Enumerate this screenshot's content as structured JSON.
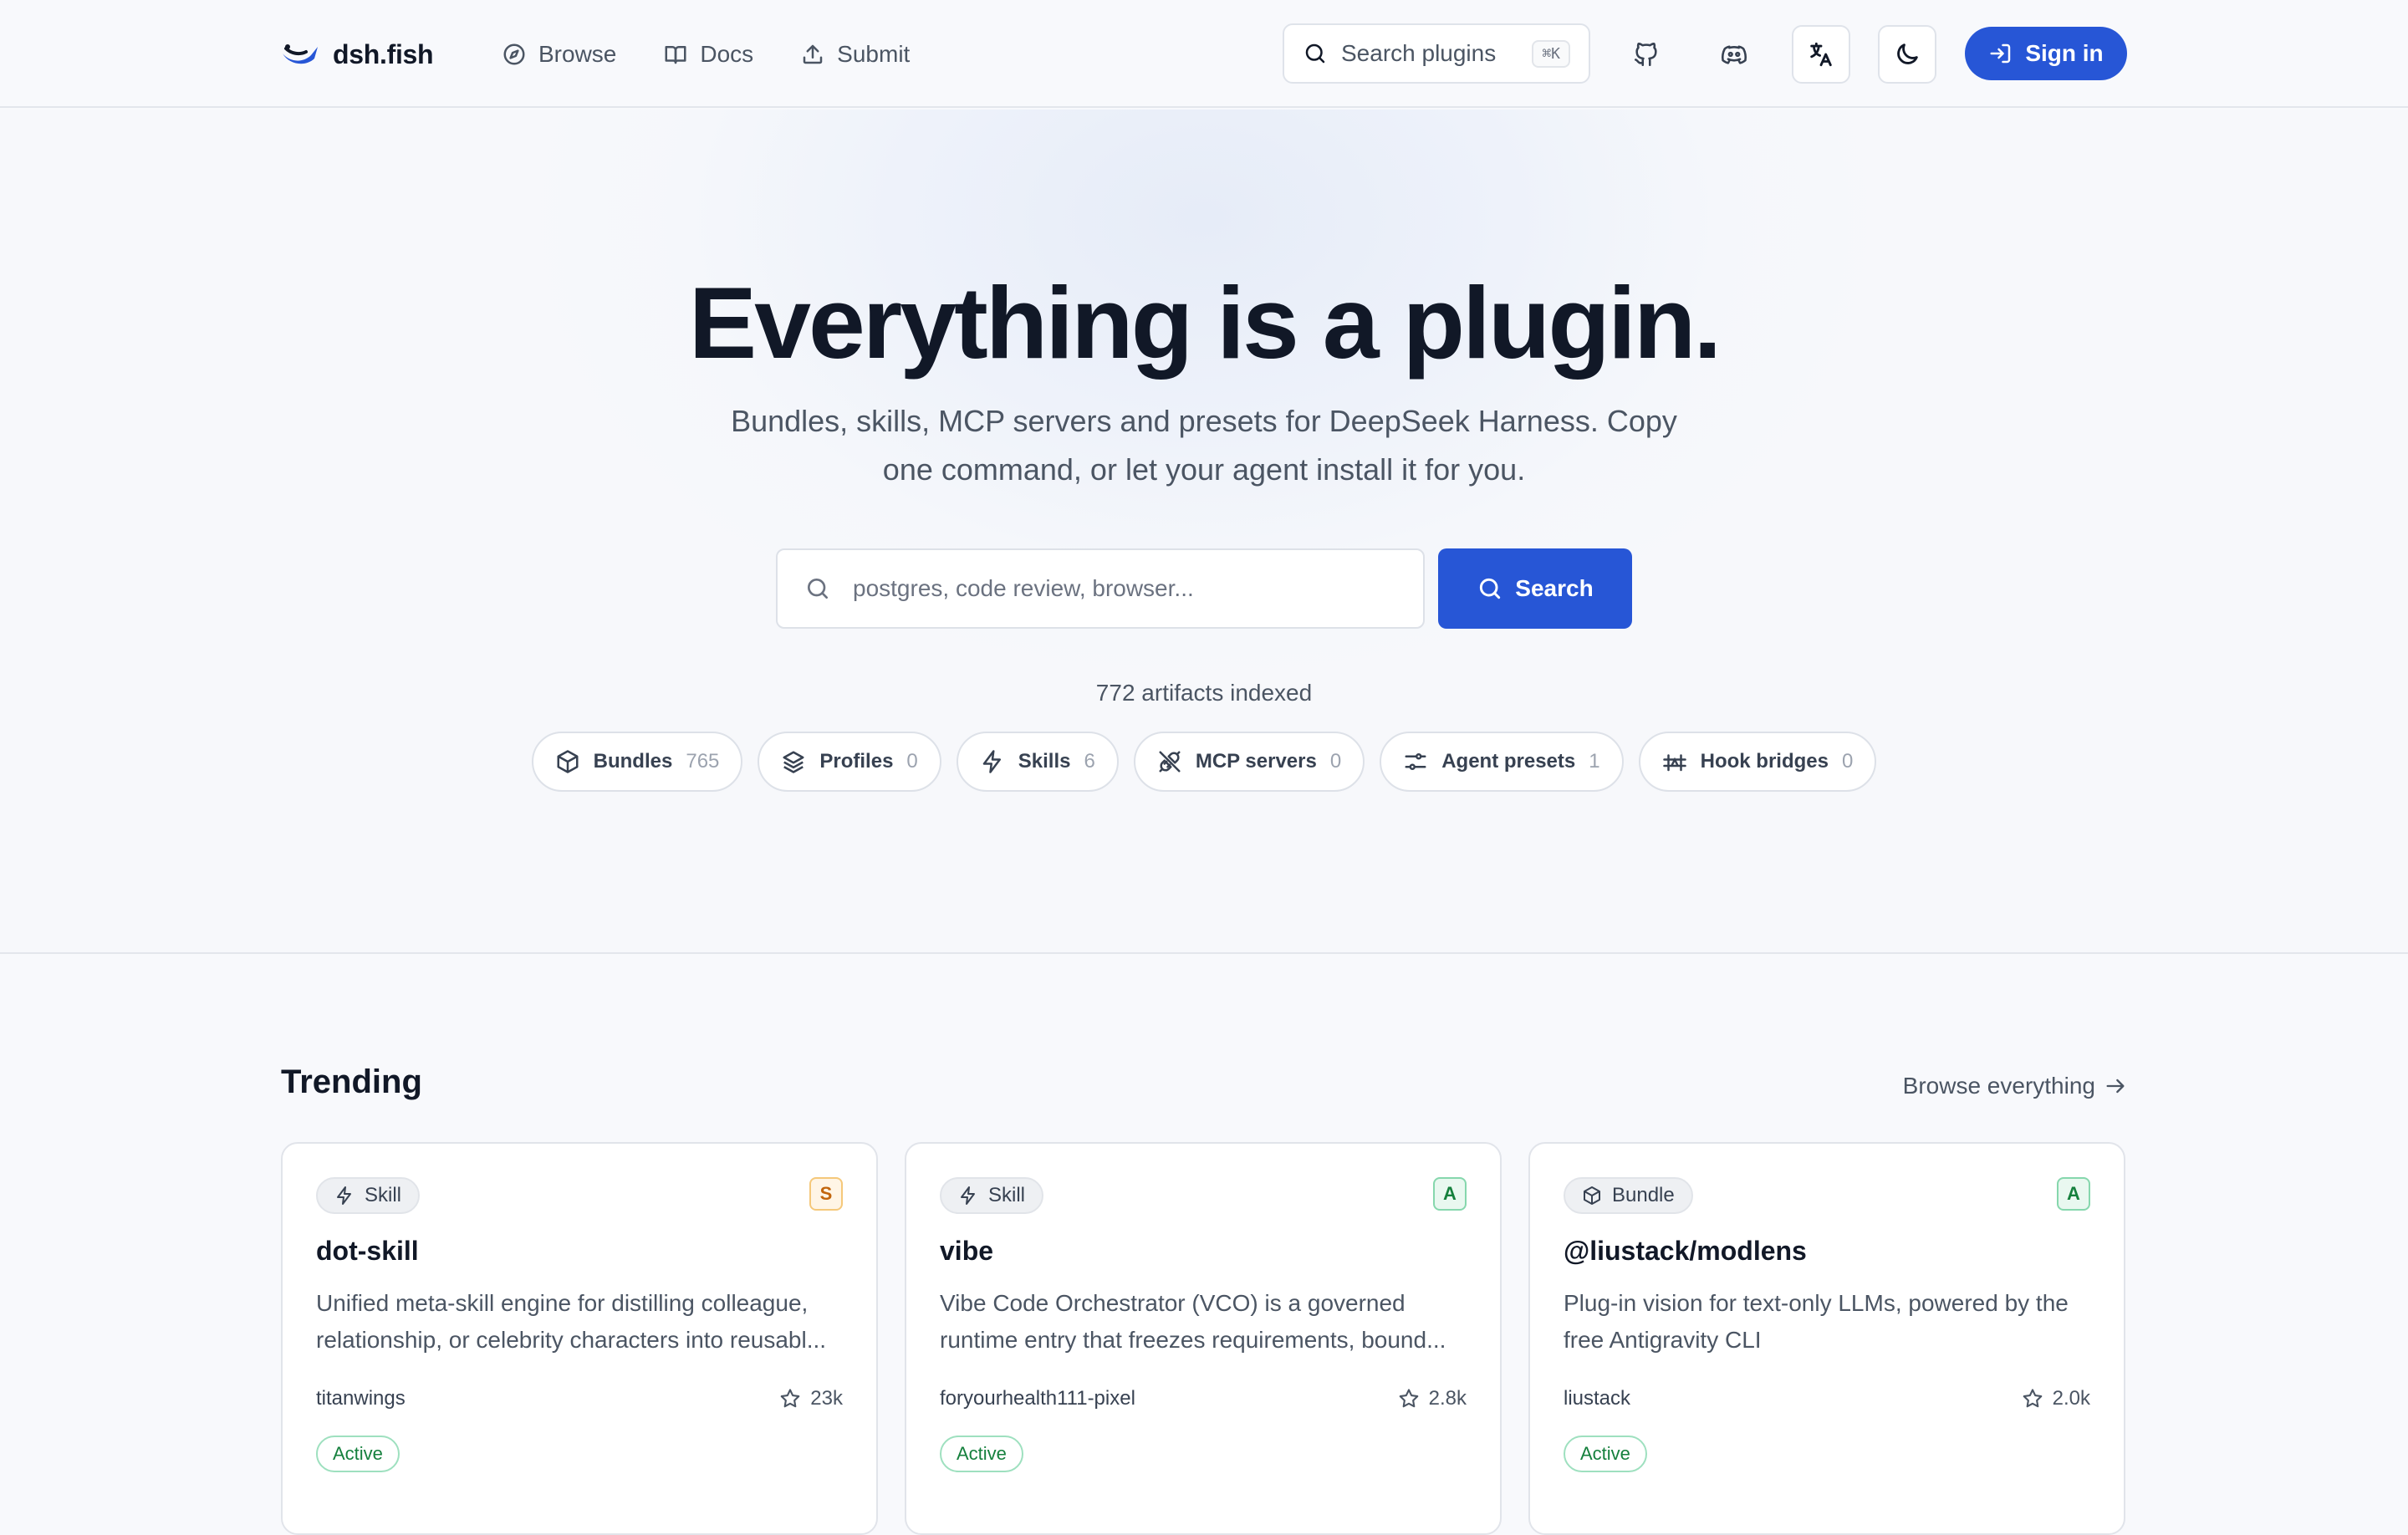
{
  "brand": {
    "name": "dsh.fish",
    "accent": "#2756d6"
  },
  "nav": [
    {
      "label": "Browse",
      "icon": "compass-icon"
    },
    {
      "label": "Docs",
      "icon": "book-icon"
    },
    {
      "label": "Submit",
      "icon": "upload-icon"
    }
  ],
  "header": {
    "search_placeholder": "Search plugins",
    "search_shortcut": "⌘K",
    "sign_in_label": "Sign in"
  },
  "hero": {
    "title": "Everything is a plugin.",
    "subtitle": "Bundles, skills, MCP servers and presets for DeepSeek Harness. Copy one command, or let your agent install it for you.",
    "search_placeholder": "postgres, code review, browser...",
    "search_button": "Search",
    "indexed_text": "772 artifacts indexed"
  },
  "categories": [
    {
      "label": "Bundles",
      "count": "765",
      "icon": "cube-icon"
    },
    {
      "label": "Profiles",
      "count": "0",
      "icon": "layers-icon"
    },
    {
      "label": "Skills",
      "count": "6",
      "icon": "bolt-icon"
    },
    {
      "label": "MCP servers",
      "count": "0",
      "icon": "plug-icon"
    },
    {
      "label": "Agent presets",
      "count": "1",
      "icon": "sliders-icon"
    },
    {
      "label": "Hook bridges",
      "count": "0",
      "icon": "bridge-icon"
    }
  ],
  "trending": {
    "title": "Trending",
    "browse_all": "Browse everything",
    "cards": [
      {
        "type": "Skill",
        "type_icon": "bolt-icon",
        "grade": "S",
        "name": "dot-skill",
        "description": "Unified meta-skill engine for distilling colleague, relationship, or celebrity characters into reusabl...",
        "author": "titanwings",
        "stars": "23k",
        "status": "Active"
      },
      {
        "type": "Skill",
        "type_icon": "bolt-icon",
        "grade": "A",
        "name": "vibe",
        "description": "Vibe Code Orchestrator (VCO) is a governed runtime entry that freezes requirements, bound...",
        "author": "foryourhealth111-pixel",
        "stars": "2.8k",
        "status": "Active"
      },
      {
        "type": "Bundle",
        "type_icon": "cube-icon",
        "grade": "A",
        "name": "@liustack/modlens",
        "description": "Plug-in vision for text-only LLMs, powered by the free Antigravity CLI",
        "author": "liustack",
        "stars": "2.0k",
        "status": "Active"
      }
    ]
  }
}
